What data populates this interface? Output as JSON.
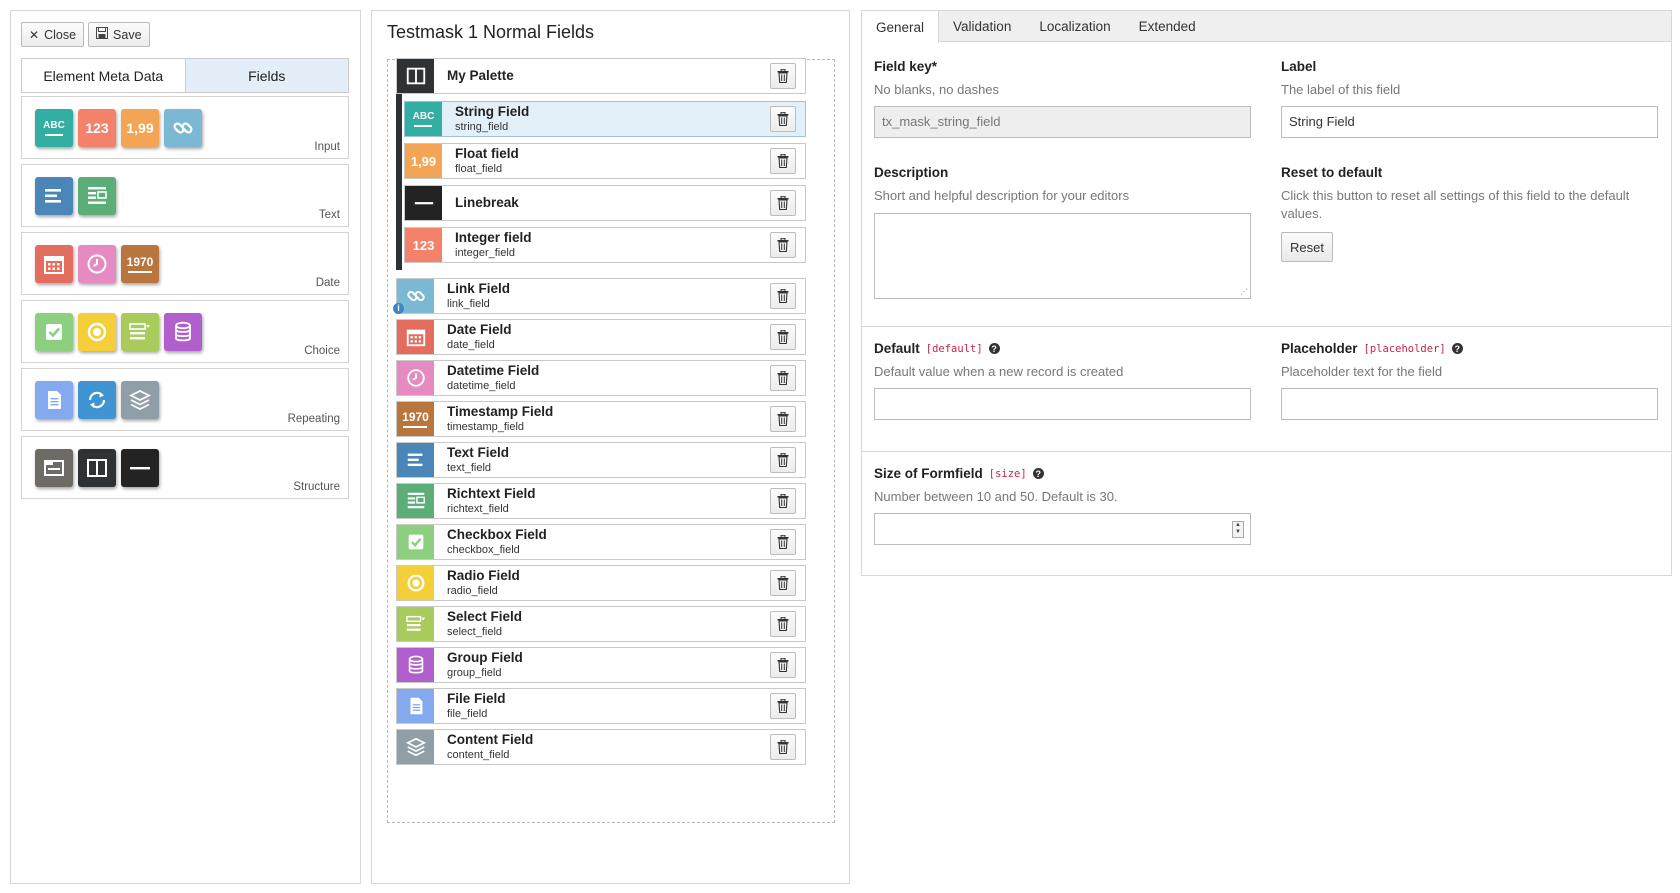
{
  "toolbar": {
    "close_label": "Close",
    "save_label": "Save"
  },
  "left_tabs": [
    {
      "label": "Element Meta Data",
      "active": false
    },
    {
      "label": "Fields",
      "active": true
    }
  ],
  "groups": [
    {
      "label": "Input",
      "icons": [
        "string-icon",
        "integer-icon",
        "float-icon",
        "link-icon"
      ]
    },
    {
      "label": "Text",
      "icons": [
        "text-icon",
        "richtext-icon"
      ]
    },
    {
      "label": "Date",
      "icons": [
        "date-icon",
        "datetime-icon",
        "timestamp-icon"
      ]
    },
    {
      "label": "Choice",
      "icons": [
        "checkbox-icon",
        "radio-icon",
        "select-icon",
        "group-icon"
      ]
    },
    {
      "label": "Repeating",
      "icons": [
        "file-icon",
        "inline-icon",
        "content-icon"
      ]
    },
    {
      "label": "Structure",
      "icons": [
        "tab-icon",
        "palette-icon",
        "linebreak-icon"
      ]
    }
  ],
  "icon_text": {
    "string": "ABC",
    "integer": "123",
    "float": "1,99",
    "timestamp": "1970"
  },
  "colors": {
    "string": "#33aea3",
    "integer": "#f4826b",
    "float": "#f4a455",
    "link": "#7ab8d4",
    "text": "#4a87b8",
    "richtext": "#5cae78",
    "date": "#e36e5f",
    "datetime": "#e58bc2",
    "timestamp": "#b8763e",
    "checkbox": "#8ccf7e",
    "radio": "#f5cf3a",
    "select": "#a9cb5c",
    "group": "#b15fcc",
    "file": "#84a9ef",
    "inline": "#3f95d1",
    "content": "#8f9ea7",
    "tab": "#6e6a66",
    "palette": "#2f3234",
    "linebreak": "#232323",
    "accent": "#e3eef8"
  },
  "mask_title": "Testmask 1 Normal Fields",
  "fields": [
    {
      "type": "palette",
      "title": "My Palette",
      "key": ""
    },
    {
      "type": "string",
      "title": "String Field",
      "key": "string_field"
    },
    {
      "type": "float",
      "title": "Float field",
      "key": "float_field"
    },
    {
      "type": "linebreak",
      "title": "Linebreak",
      "key": ""
    },
    {
      "type": "integer",
      "title": "Integer field",
      "key": "integer_field"
    },
    {
      "type": "link",
      "title": "Link Field",
      "key": "link_field"
    },
    {
      "type": "date",
      "title": "Date Field",
      "key": "date_field"
    },
    {
      "type": "datetime",
      "title": "Datetime Field",
      "key": "datetime_field"
    },
    {
      "type": "timestamp",
      "title": "Timestamp Field",
      "key": "timestamp_field"
    },
    {
      "type": "text",
      "title": "Text Field",
      "key": "text_field"
    },
    {
      "type": "richtext",
      "title": "Richtext Field",
      "key": "richtext_field"
    },
    {
      "type": "checkbox",
      "title": "Checkbox Field",
      "key": "checkbox_field"
    },
    {
      "type": "radio",
      "title": "Radio Field",
      "key": "radio_field"
    },
    {
      "type": "select",
      "title": "Select Field",
      "key": "select_field"
    },
    {
      "type": "group",
      "title": "Group Field",
      "key": "group_field"
    },
    {
      "type": "file",
      "title": "File Field",
      "key": "file_field"
    },
    {
      "type": "content",
      "title": "Content Field",
      "key": "content_field"
    }
  ],
  "right_tabs": [
    {
      "label": "General",
      "active": true
    },
    {
      "label": "Validation",
      "active": false
    },
    {
      "label": "Localization",
      "active": false
    },
    {
      "label": "Extended",
      "active": false
    }
  ],
  "form": {
    "field_key": {
      "label": "Field key*",
      "desc": "No blanks, no dashes",
      "value": "tx_mask_string_field"
    },
    "label": {
      "label": "Label",
      "desc": "The label of this field",
      "value": "String Field"
    },
    "description": {
      "label": "Description",
      "desc": "Short and helpful description for your editors",
      "value": ""
    },
    "reset": {
      "label": "Reset to default",
      "desc": "Click this button to reset all settings of this field to the default values.",
      "button": "Reset"
    },
    "default": {
      "label": "Default",
      "code": "[default]",
      "desc": "Default value when a new record is created",
      "value": ""
    },
    "placeholder": {
      "label": "Placeholder",
      "code": "[placeholder]",
      "desc": "Placeholder text for the field",
      "value": ""
    },
    "size": {
      "label": "Size of Formfield",
      "code": "[size]",
      "desc": "Number between 10 and 50. Default is 30.",
      "value": ""
    }
  }
}
